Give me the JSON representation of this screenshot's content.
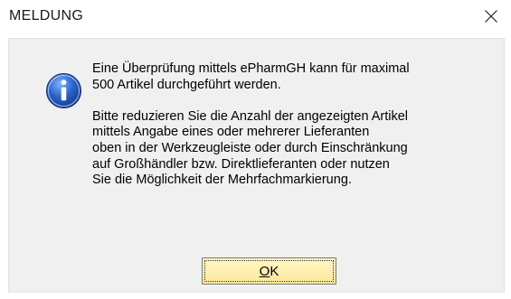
{
  "dialog": {
    "title": "MELDUNG",
    "close_icon": "close-icon",
    "icon": "information-icon",
    "message_line_1": "Eine Überprüfung mittels ePharmGH kann für maximal\n500 Artikel durchgeführt werden.",
    "message_line_2": "Bitte reduzieren Sie die Anzahl der angezeigten Artikel\nmittels Angabe eines oder mehrerer Lieferanten\noben in der Werkzeugleiste oder durch Einschränkung\nauf Großhändler bzw. Direktlieferanten oder nutzen\nSie die Möglichkeit der Mehrfachmarkierung.",
    "ok_label_mnemonic": "O",
    "ok_label_rest": "K"
  },
  "colors": {
    "content_background": "#f0f0f0",
    "button_background": "#fde79a",
    "icon_blue": "#1e56b3"
  }
}
